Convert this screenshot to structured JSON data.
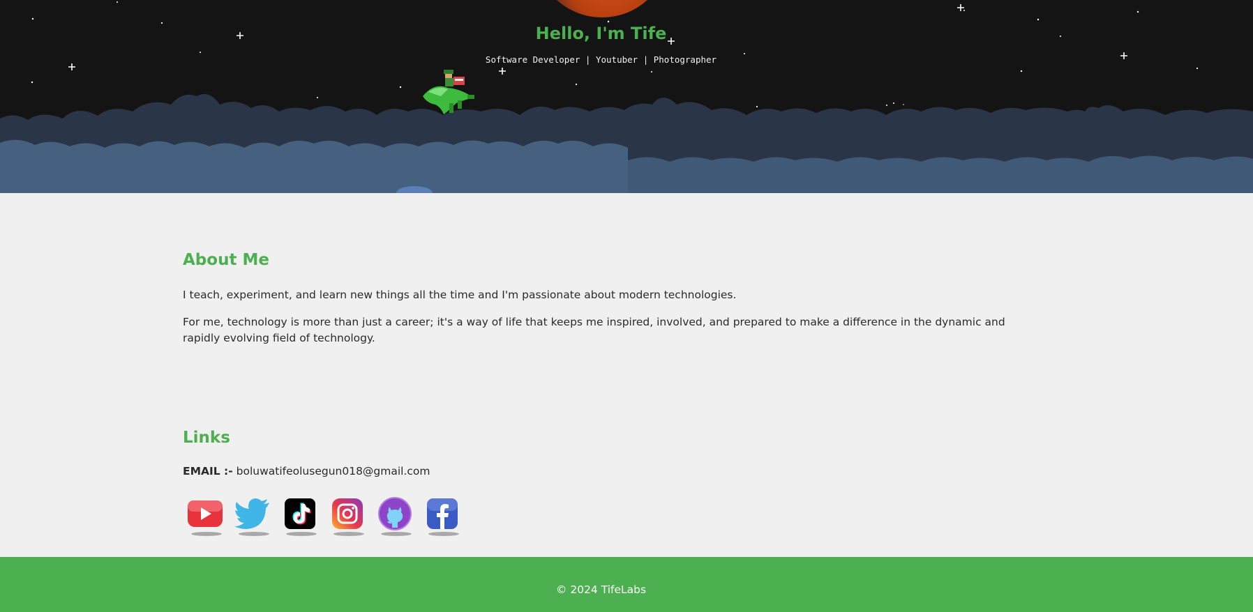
{
  "hero": {
    "greeting": "Hello, I'm Tife",
    "subtitle": "Software Developer | Youtuber | Photographer"
  },
  "about": {
    "title": "About Me",
    "paragraphs": [
      "I teach, experiment, and learn new things all the time and I'm passionate about modern technologies.",
      "For me, technology is more than just a career; it's a way of life that keeps me inspired, involved, and prepared to make a difference in the dynamic and rapidly evolving field of technology."
    ]
  },
  "links": {
    "title": "Links",
    "email_label": "EMAIL :-",
    "email_value": "boluwatifeolusegun018@gmail.com",
    "socials": [
      {
        "name": "youtube-icon",
        "color": "#e8323c"
      },
      {
        "name": "twitter-icon",
        "color": "#3fb5e8"
      },
      {
        "name": "tiktok-icon",
        "color": "#000000"
      },
      {
        "name": "instagram-icon",
        "color": "#c13584"
      },
      {
        "name": "github-icon",
        "color": "#8e44c9"
      },
      {
        "name": "facebook-icon",
        "color": "#3b5bc4"
      }
    ]
  },
  "footer": {
    "text": "© 2024 TifeLabs"
  },
  "colors": {
    "accent": "#4caf50",
    "hero_bg": "#141414",
    "page_bg": "#f0f0f0"
  }
}
